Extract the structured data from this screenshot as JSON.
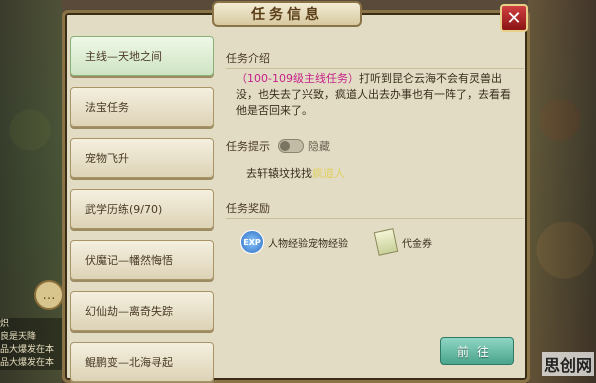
{
  "window": {
    "title": "任务信息",
    "close_glyph": "✕"
  },
  "quest_list": [
    {
      "label": "主线—天地之间",
      "active": true
    },
    {
      "label": "法宝任务",
      "active": false
    },
    {
      "label": "宠物飞升",
      "active": false
    },
    {
      "label": "武学历练(9/70)",
      "active": false
    },
    {
      "label": "伏魔记—幡然悔悟",
      "active": false
    },
    {
      "label": "幻仙劫—离奇失踪",
      "active": false
    },
    {
      "label": "鲲鹏变—北海寻起",
      "active": false
    }
  ],
  "detail": {
    "intro_heading": "任务介绍",
    "intro_tag": "（100-109级主线任务）",
    "intro_text": "打听到昆仑云海不会有灵兽出没，也失去了兴致，疯道人出去办事也有一阵了，去看看他是否回来了。",
    "hint_heading": "任务提示",
    "hint_toggle_state": "隐藏",
    "hint_prefix": "去轩辕坟找找",
    "hint_target": "疯道人",
    "reward_heading": "任务奖励",
    "rewards": [
      {
        "icon": "exp-icon",
        "icon_text": "EXP",
        "label": "人物经验宠物经验"
      },
      {
        "icon": "coupon-icon",
        "label": "代金券"
      }
    ],
    "go_button": "前往"
  },
  "chat": {
    "lines": [
      {
        "name": "",
        "text": "炽"
      },
      {
        "name": "",
        "text": "良是天降"
      },
      {
        "name": "",
        "text": "品大爆发在本"
      },
      {
        "name": "",
        "text": "品大爆发在本"
      }
    ]
  },
  "watermark": "思创网",
  "colors": {
    "accent_magenta": "#c6208a",
    "go_button": "#4aa48c",
    "close_button": "#b02020"
  }
}
